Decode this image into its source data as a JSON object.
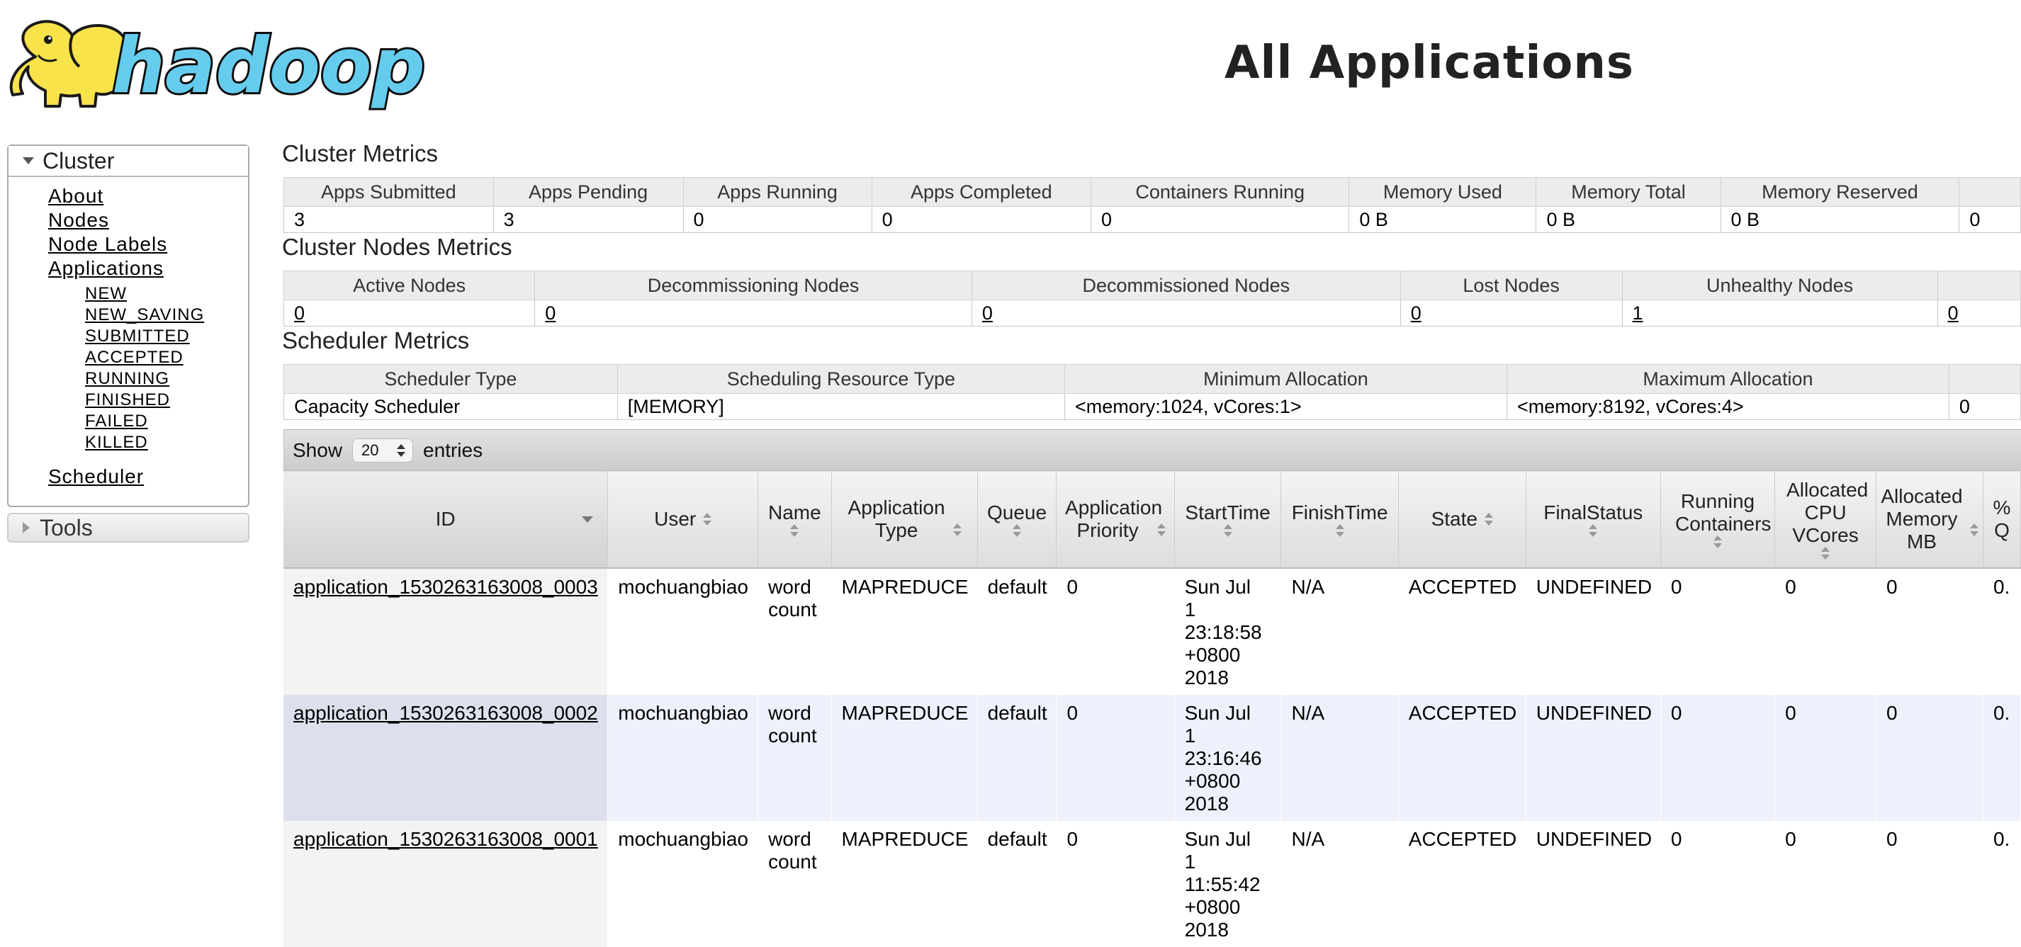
{
  "header": {
    "page_title": "All Applications"
  },
  "sidebar": {
    "cluster_label": "Cluster",
    "links": [
      "About",
      "Nodes",
      "Node Labels",
      "Applications"
    ],
    "app_states": [
      "NEW",
      "NEW_SAVING",
      "SUBMITTED",
      "ACCEPTED",
      "RUNNING",
      "FINISHED",
      "FAILED",
      "KILLED"
    ],
    "scheduler_label": "Scheduler",
    "tools_label": "Tools"
  },
  "cluster_metrics": {
    "title": "Cluster Metrics",
    "headers": [
      "Apps Submitted",
      "Apps Pending",
      "Apps Running",
      "Apps Completed",
      "Containers Running",
      "Memory Used",
      "Memory Total",
      "Memory Reserved",
      ""
    ],
    "values": [
      "3",
      "3",
      "0",
      "0",
      "0",
      "0 B",
      "0 B",
      "0 B",
      "0"
    ]
  },
  "nodes_metrics": {
    "title": "Cluster Nodes Metrics",
    "headers": [
      "Active Nodes",
      "Decommissioning Nodes",
      "Decommissioned Nodes",
      "Lost Nodes",
      "Unhealthy Nodes",
      ""
    ],
    "values": [
      "0",
      "0",
      "0",
      "0",
      "1",
      "0"
    ]
  },
  "scheduler_metrics": {
    "title": "Scheduler Metrics",
    "headers": [
      "Scheduler Type",
      "Scheduling Resource Type",
      "Minimum Allocation",
      "Maximum Allocation",
      ""
    ],
    "values": [
      "Capacity Scheduler",
      "[MEMORY]",
      "<memory:1024, vCores:1>",
      "<memory:8192, vCores:4>",
      "0"
    ]
  },
  "entries": {
    "show_label": "Show",
    "selected": "20",
    "entries_label": "entries"
  },
  "apps_table": {
    "columns": [
      {
        "label": "ID"
      },
      {
        "label": "User"
      },
      {
        "label": "Name"
      },
      {
        "label": "Application Type"
      },
      {
        "label": "Queue"
      },
      {
        "label": "Application Priority"
      },
      {
        "label": "StartTime"
      },
      {
        "label": "FinishTime"
      },
      {
        "label": "State"
      },
      {
        "label": "FinalStatus"
      },
      {
        "label": "Running Containers"
      },
      {
        "label": "Allocated CPU VCores"
      },
      {
        "label": "Allocated Memory MB"
      },
      {
        "label": "% Q"
      }
    ],
    "rows": [
      {
        "id": "application_1530263163008_0003",
        "user": "mochuangbiao",
        "name": "word count",
        "type": "MAPREDUCE",
        "queue": "default",
        "priority": "0",
        "start": "Sun Jul 1 23:18:58 +0800 2018",
        "finish": "N/A",
        "state": "ACCEPTED",
        "final": "UNDEFINED",
        "containers": "0",
        "vcores": "0",
        "memory": "0",
        "pct": "0."
      },
      {
        "id": "application_1530263163008_0002",
        "user": "mochuangbiao",
        "name": "word count",
        "type": "MAPREDUCE",
        "queue": "default",
        "priority": "0",
        "start": "Sun Jul 1 23:16:46 +0800 2018",
        "finish": "N/A",
        "state": "ACCEPTED",
        "final": "UNDEFINED",
        "containers": "0",
        "vcores": "0",
        "memory": "0",
        "pct": "0."
      },
      {
        "id": "application_1530263163008_0001",
        "user": "mochuangbiao",
        "name": "word count",
        "type": "MAPREDUCE",
        "queue": "default",
        "priority": "0",
        "start": "Sun Jul 1 11:55:42 +0800 2018",
        "finish": "N/A",
        "state": "ACCEPTED",
        "final": "UNDEFINED",
        "containers": "0",
        "vcores": "0",
        "memory": "0",
        "pct": "0."
      }
    ]
  },
  "logo": {
    "text": "hadoop"
  },
  "colors": {
    "logo_yellow": "#f8e34a",
    "logo_blue": "#66ccee",
    "header_gray": "#ececec",
    "even_row": "#eef1fb"
  }
}
